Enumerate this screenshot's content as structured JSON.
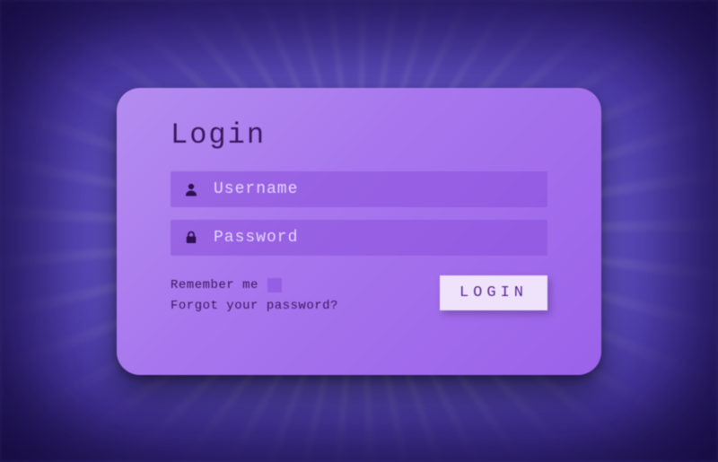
{
  "title": "Login",
  "username": {
    "placeholder": "Username",
    "value": ""
  },
  "password": {
    "placeholder": "Password",
    "value": ""
  },
  "remember_label": "Remember me",
  "forgot_label": "Forgot your password?",
  "login_button": "LOGIN",
  "colors": {
    "card_gradient_start": "#b48df0",
    "card_gradient_end": "#9a62ea",
    "field_bg": "#8a50dc",
    "button_bg": "#efe2fb",
    "text_dark": "#3a1760"
  }
}
